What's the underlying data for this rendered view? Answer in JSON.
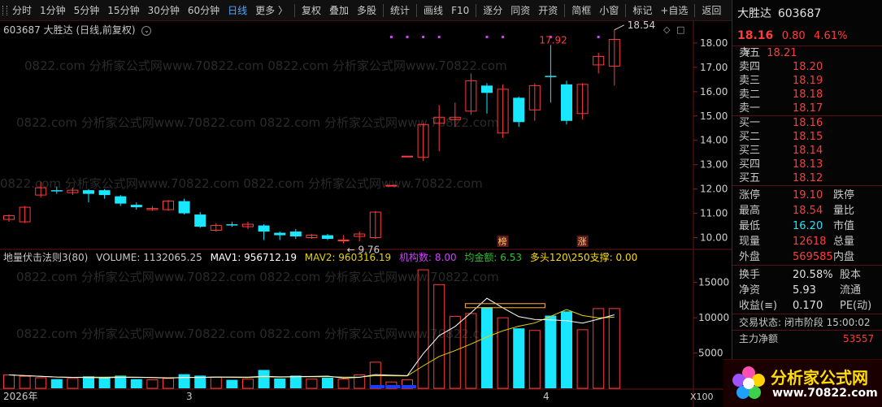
{
  "toolbar": {
    "items": [
      "分时",
      "1分钟",
      "5分钟",
      "15分钟",
      "30分钟",
      "60分钟",
      "日线",
      "更多 〉",
      "复权",
      "叠加",
      "多股",
      "统计",
      "画线",
      "F10",
      "逐分",
      "同资",
      "开资",
      "简框",
      "小窗",
      "标记",
      "+自选",
      "返回"
    ],
    "active_index": 6
  },
  "chart": {
    "title": "603687 大胜达 (日线,前复权)",
    "chevron_icon": "chevron-down-icon",
    "window_icons": [
      "◇",
      "□"
    ],
    "indicator": {
      "name": "地量伏击法则3(80)",
      "volume": "VOLUME: 1132065.25",
      "mav1": "MAV1: 956712.19",
      "mav2": "MAV2: 960316.19",
      "jigou": "机构数: 8.00",
      "junjin": "均金额: 6.53",
      "duotou": "多头120\\250支撑: 0.00"
    },
    "colors": {
      "up": "#ff3b3b",
      "down": "#19e6ff",
      "mav1": "#ffffff",
      "mav2": "#e6d200",
      "jigou": "#d040ff",
      "junjin": "#30c030",
      "duotou": "#ffdd00"
    }
  },
  "chart_data": {
    "type": "candlestick",
    "price_axis": {
      "ticks": [
        18.0,
        17.0,
        16.0,
        15.0,
        14.0,
        13.0,
        12.0,
        11.0,
        10.0
      ],
      "range": [
        9.55,
        18.9
      ]
    },
    "volume_axis": {
      "ticks": [
        15000,
        10000,
        5000
      ],
      "unit_label": "X100",
      "range": [
        0,
        17500
      ]
    },
    "x_labels": [
      "2026年",
      "3",
      "4"
    ],
    "annotations": {
      "high": "18.54",
      "low": "9.76",
      "peak": "17.92",
      "badge1": "榜",
      "badge2": "涨"
    },
    "watermark": "0822.com 分析家公式网www.70822.com",
    "candles": [
      {
        "o": 10.75,
        "c": 10.9,
        "h": 10.95,
        "l": 10.65,
        "v": 1900
      },
      {
        "o": 10.65,
        "c": 11.25,
        "h": 11.3,
        "l": 10.6,
        "v": 1700
      },
      {
        "o": 11.75,
        "c": 12.05,
        "h": 12.3,
        "l": 11.65,
        "v": 1500
      },
      {
        "o": 11.95,
        "c": 11.9,
        "h": 12.1,
        "l": 11.8,
        "v": 1300
      },
      {
        "o": 11.85,
        "c": 11.95,
        "h": 12.05,
        "l": 11.75,
        "v": 1400
      },
      {
        "o": 11.95,
        "c": 11.8,
        "h": 12.0,
        "l": 11.45,
        "v": 1700
      },
      {
        "o": 11.95,
        "c": 11.75,
        "h": 12.0,
        "l": 11.6,
        "v": 1600
      },
      {
        "o": 11.7,
        "c": 11.4,
        "h": 11.75,
        "l": 11.3,
        "v": 1800
      },
      {
        "o": 11.35,
        "c": 11.25,
        "h": 11.45,
        "l": 11.15,
        "v": 1300
      },
      {
        "o": 11.15,
        "c": 11.2,
        "h": 11.3,
        "l": 11.1,
        "v": 1200
      },
      {
        "o": 11.15,
        "c": 11.5,
        "h": 11.55,
        "l": 11.1,
        "v": 1400
      },
      {
        "o": 11.5,
        "c": 11.0,
        "h": 11.6,
        "l": 10.95,
        "v": 2000
      },
      {
        "o": 10.95,
        "c": 10.45,
        "h": 11.05,
        "l": 10.4,
        "v": 1800
      },
      {
        "o": 10.3,
        "c": 10.5,
        "h": 10.6,
        "l": 10.25,
        "v": 1600
      },
      {
        "o": 10.55,
        "c": 10.5,
        "h": 10.65,
        "l": 10.45,
        "v": 1200
      },
      {
        "o": 10.45,
        "c": 10.55,
        "h": 10.65,
        "l": 10.35,
        "v": 1300
      },
      {
        "o": 10.5,
        "c": 10.25,
        "h": 10.55,
        "l": 9.9,
        "v": 2600
      },
      {
        "o": 10.2,
        "c": 10.1,
        "h": 10.25,
        "l": 9.9,
        "v": 1400
      },
      {
        "o": 10.25,
        "c": 10.05,
        "h": 10.35,
        "l": 9.95,
        "v": 1800
      },
      {
        "o": 10.0,
        "c": 10.1,
        "h": 10.15,
        "l": 9.95,
        "v": 1300
      },
      {
        "o": 10.1,
        "c": 9.95,
        "h": 10.15,
        "l": 9.9,
        "v": 1500
      },
      {
        "o": 9.9,
        "c": 9.9,
        "h": 10.1,
        "l": 9.76,
        "v": 1300
      },
      {
        "o": 10.05,
        "c": 10.15,
        "h": 10.25,
        "l": 9.85,
        "v": 1900
      },
      {
        "o": 10.0,
        "c": 11.05,
        "h": 11.1,
        "l": 9.95,
        "v": 3700
      },
      {
        "o": 12.15,
        "c": 12.15,
        "h": 12.15,
        "l": 12.15,
        "v": 900
      },
      {
        "o": 13.35,
        "c": 13.35,
        "h": 13.35,
        "l": 13.35,
        "v": 1200
      },
      {
        "o": 13.3,
        "c": 14.65,
        "h": 14.7,
        "l": 13.15,
        "v": 16800
      },
      {
        "o": 14.7,
        "c": 14.95,
        "h": 15.45,
        "l": 13.55,
        "v": 14700
      },
      {
        "o": 14.85,
        "c": 14.95,
        "h": 15.55,
        "l": 14.55,
        "v": 10200
      },
      {
        "o": 15.2,
        "c": 16.45,
        "h": 16.75,
        "l": 15.05,
        "v": 10600
      },
      {
        "o": 16.25,
        "c": 15.95,
        "h": 16.35,
        "l": 15.1,
        "v": 11500
      },
      {
        "o": 14.3,
        "c": 16.1,
        "h": 16.3,
        "l": 14.1,
        "v": 10000
      },
      {
        "o": 15.75,
        "c": 14.75,
        "h": 15.8,
        "l": 14.55,
        "v": 8500
      },
      {
        "o": 15.25,
        "c": 16.25,
        "h": 16.35,
        "l": 14.8,
        "v": 8200
      },
      {
        "o": 16.65,
        "c": 16.6,
        "h": 17.92,
        "l": 15.55,
        "v": 10300
      },
      {
        "o": 16.3,
        "c": 14.8,
        "h": 16.45,
        "l": 14.65,
        "v": 10900
      },
      {
        "o": 15.1,
        "c": 16.3,
        "h": 16.35,
        "l": 14.85,
        "v": 8300
      },
      {
        "o": 17.1,
        "c": 17.45,
        "h": 17.6,
        "l": 16.75,
        "v": 11300
      },
      {
        "o": 17.05,
        "c": 18.15,
        "h": 18.54,
        "l": 16.25,
        "v": 11300
      }
    ]
  },
  "side": {
    "name": "大胜达",
    "code": "603687",
    "price": "18.16",
    "change": "0.80",
    "pct": "4.61%",
    "sell_tag": "¥",
    "sells": [
      {
        "label": "卖五",
        "price": "18.21"
      },
      {
        "label": "卖四",
        "price": "18.20"
      },
      {
        "label": "卖三",
        "price": "18.19"
      },
      {
        "label": "卖二",
        "price": "18.18"
      },
      {
        "label": "卖一",
        "price": "18.17"
      }
    ],
    "buys": [
      {
        "label": "买一",
        "price": "18.16"
      },
      {
        "label": "买二",
        "price": "18.15"
      },
      {
        "label": "买三",
        "price": "18.14"
      },
      {
        "label": "买四",
        "price": "18.13"
      },
      {
        "label": "买五",
        "price": "18.12"
      }
    ],
    "stats": [
      {
        "l": "涨停",
        "v": "19.10",
        "l2": "跌停",
        "c": "red"
      },
      {
        "l": "最高",
        "v": "18.54",
        "l2": "量比",
        "c": "red"
      },
      {
        "l": "最低",
        "v": "16.20",
        "l2": "市值",
        "c": "cyan"
      },
      {
        "l": "现量",
        "v": "12618",
        "l2": "总量",
        "c": "red"
      },
      {
        "l": "外盘",
        "v": "569585",
        "l2": "内盘",
        "c": "red"
      }
    ],
    "stats2": [
      {
        "l": "换手",
        "v": "20.58%",
        "l2": "股本",
        "c": "white"
      },
      {
        "l": "净资",
        "v": "5.93",
        "l2": "流通",
        "c": "white"
      },
      {
        "l": "收益(≡)",
        "v": "0.170",
        "l2": "PE(动)",
        "c": "white"
      }
    ],
    "trade_status": "交易状态: 闭市阶段 15:00:02",
    "main_flow_label": "主力净额",
    "main_flow_value": "53557"
  },
  "logo": {
    "title": "分析家公式网",
    "url": "www.70822.com"
  }
}
